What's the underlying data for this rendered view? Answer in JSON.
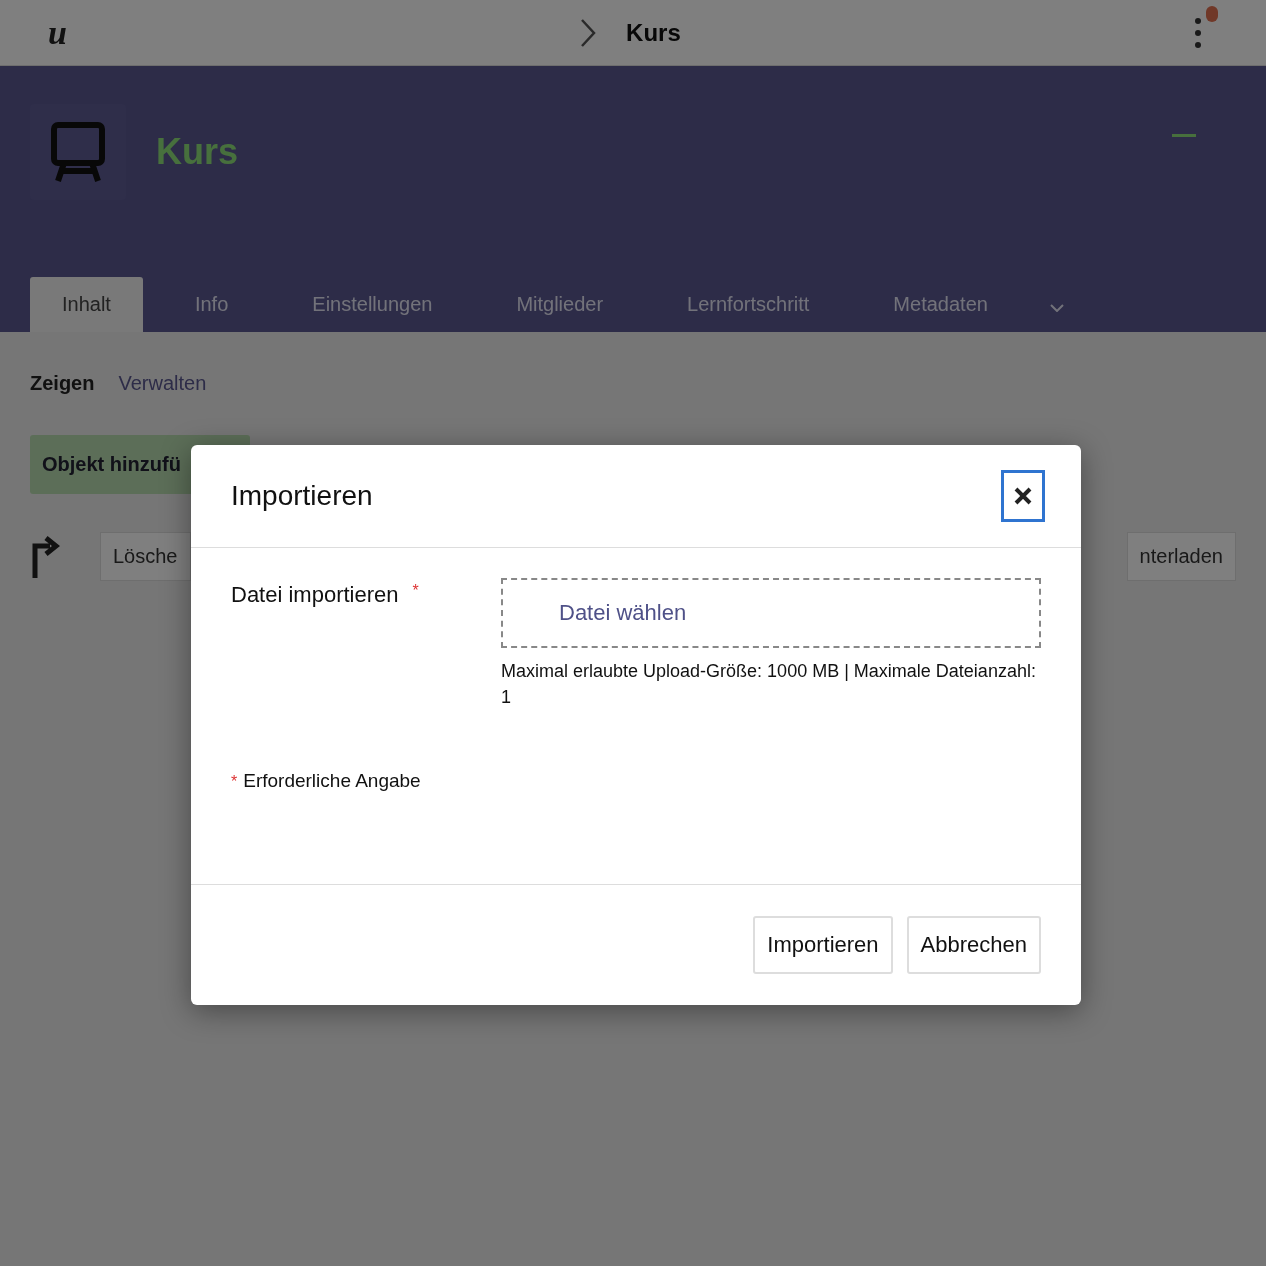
{
  "top_bar": {
    "logo": "u",
    "breadcrumb": "Kurs"
  },
  "header": {
    "title": "Kurs"
  },
  "tabs": [
    {
      "label": "Inhalt",
      "selected": true
    },
    {
      "label": "Info",
      "selected": false
    },
    {
      "label": "Einstellungen",
      "selected": false
    },
    {
      "label": "Mitglieder",
      "selected": false
    },
    {
      "label": "Lernfortschritt",
      "selected": false
    },
    {
      "label": "Metadaten",
      "selected": false
    }
  ],
  "subtabs": [
    {
      "label": "Zeigen",
      "selected": true
    },
    {
      "label": "Verwalten",
      "selected": false
    }
  ],
  "add_button": "Objekt hinzufü",
  "toolbar": {
    "left_button": "Lösche",
    "right_button": "nterladen"
  },
  "dialog": {
    "title": "Importieren",
    "field_label": "Datei importieren",
    "required_mark": "*",
    "file_button": "Datei wählen",
    "hint": "Maximal erlaubte Upload-Größe: 1000 MB | Maximale Dateianzahl: 1",
    "required_note": "Erforderliche Angabe",
    "buttons": [
      "Importieren",
      "Abbrechen"
    ]
  }
}
